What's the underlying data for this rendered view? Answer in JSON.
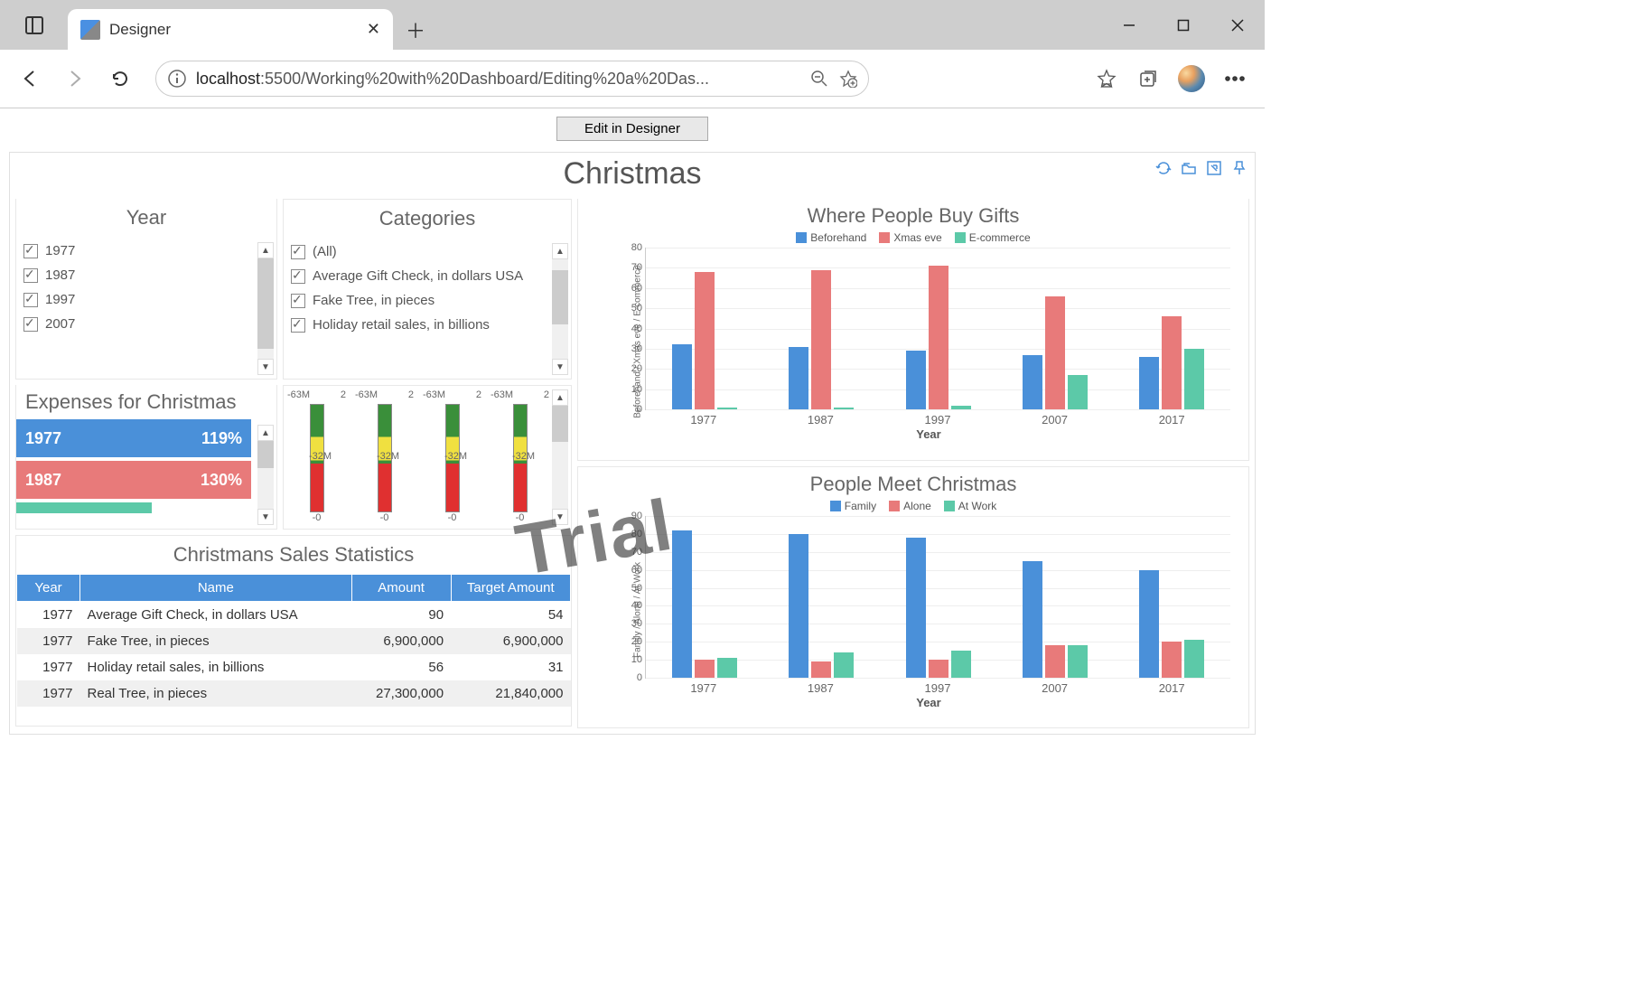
{
  "browser": {
    "tab_title": "Designer",
    "url_host": "localhost",
    "url_path": ":5500/Working%20with%20Dashboard/Editing%20a%20Das..."
  },
  "page": {
    "edit_button": "Edit in Designer"
  },
  "dashboard": {
    "title": "Christmas",
    "year_filter": {
      "title": "Year",
      "items": [
        {
          "label": "1977",
          "checked": true
        },
        {
          "label": "1987",
          "checked": true
        },
        {
          "label": "1997",
          "checked": true
        },
        {
          "label": "2007",
          "checked": true
        }
      ]
    },
    "categories_filter": {
      "title": "Categories",
      "items": [
        {
          "label": "(All)",
          "checked": true
        },
        {
          "label": "Average Gift Check, in dollars USA",
          "checked": true
        },
        {
          "label": "Fake Tree, in pieces",
          "checked": true
        },
        {
          "label": "Holiday retail sales, in billions",
          "checked": true
        }
      ]
    },
    "expenses": {
      "title": "Expenses for Christmas",
      "bars": [
        {
          "year": "1977",
          "value": "119%"
        },
        {
          "year": "1987",
          "value": "130%"
        }
      ]
    },
    "gauges": {
      "top_label": "63M",
      "mid_label": "32M",
      "bottom_label": "0",
      "right_tick": "2",
      "count": 4
    },
    "table": {
      "title": "Christmans Sales Statistics",
      "headers": [
        "Year",
        "Name",
        "Amount",
        "Target Amount"
      ],
      "rows": [
        [
          "1977",
          "Average Gift Check, in dollars USA",
          "90",
          "54"
        ],
        [
          "1977",
          "Fake Tree, in pieces",
          "6,900,000",
          "6,900,000"
        ],
        [
          "1977",
          "Holiday retail sales, in billions",
          "56",
          "31"
        ],
        [
          "1977",
          "Real Tree, in pieces",
          "27,300,000",
          "21,840,000"
        ]
      ]
    },
    "watermark": "Trial"
  },
  "chart_data": [
    {
      "type": "bar",
      "title": "Where People Buy Gifts",
      "xlabel": "Year",
      "ylabel": "Beforehand / Xmas eve / E-commerce",
      "ylim": [
        0,
        80
      ],
      "y_ticks": [
        0,
        10,
        20,
        30,
        40,
        50,
        60,
        70,
        80
      ],
      "categories": [
        "1977",
        "1987",
        "1997",
        "2007",
        "2017"
      ],
      "series": [
        {
          "name": "Beforehand",
          "color": "#4a90d9",
          "values": [
            32,
            31,
            29,
            27,
            26
          ]
        },
        {
          "name": "Xmas eve",
          "color": "#e87a7a",
          "values": [
            68,
            69,
            71,
            56,
            46
          ]
        },
        {
          "name": "E-commerce",
          "color": "#5cc9a8",
          "values": [
            1,
            1,
            2,
            17,
            30
          ]
        }
      ]
    },
    {
      "type": "bar",
      "title": "People Meet Christmas",
      "xlabel": "Year",
      "ylabel": "Family / Alone / At Work",
      "ylim": [
        0,
        90
      ],
      "y_ticks": [
        0,
        10,
        20,
        30,
        40,
        50,
        60,
        70,
        80,
        90
      ],
      "categories": [
        "1977",
        "1987",
        "1997",
        "2007",
        "2017"
      ],
      "series": [
        {
          "name": "Family",
          "color": "#4a90d9",
          "values": [
            82,
            80,
            78,
            65,
            60
          ]
        },
        {
          "name": "Alone",
          "color": "#e87a7a",
          "values": [
            10,
            9,
            10,
            18,
            20
          ]
        },
        {
          "name": "At Work",
          "color": "#5cc9a8",
          "values": [
            11,
            14,
            15,
            18,
            21
          ]
        }
      ]
    }
  ]
}
